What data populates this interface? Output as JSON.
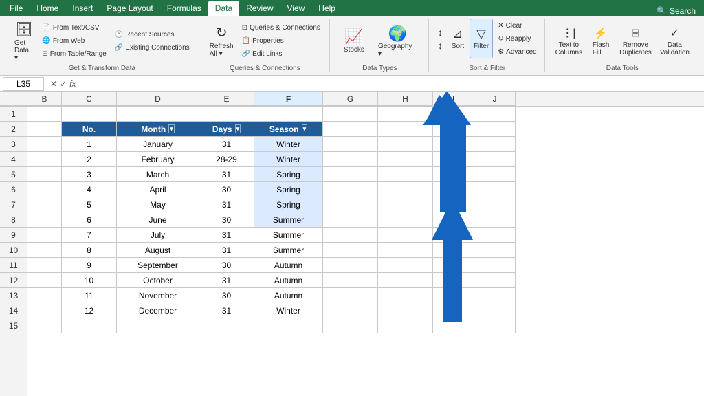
{
  "ribbon": {
    "tabs": [
      "File",
      "Home",
      "Insert",
      "Page Layout",
      "Formulas",
      "Data",
      "Review",
      "View",
      "Help"
    ],
    "active_tab": "Data",
    "groups": {
      "get_transform": {
        "label": "Get & Transform Data",
        "buttons": [
          {
            "id": "get-data",
            "label": "Get\nData",
            "icon": "🗄"
          },
          {
            "id": "from-text-csv",
            "label": "From\nText/CSV",
            "icon": "📄"
          },
          {
            "id": "from-web",
            "label": "From\nWeb",
            "icon": "🌐"
          },
          {
            "id": "from-table",
            "label": "From Table/\nRange",
            "icon": "⊞"
          },
          {
            "id": "recent-sources",
            "label": "Recent\nSources",
            "icon": "🕐"
          },
          {
            "id": "existing-connections",
            "label": "Existing\nConnections",
            "icon": "🔗"
          }
        ]
      },
      "queries": {
        "label": "Queries & Connections",
        "buttons": [
          {
            "id": "refresh-all",
            "label": "Refresh\nAll",
            "icon": "↻"
          },
          {
            "id": "queries-connections",
            "label": "Queries & Connections",
            "icon": ""
          },
          {
            "id": "properties",
            "label": "Properties",
            "icon": ""
          },
          {
            "id": "edit-links",
            "label": "Edit Links",
            "icon": ""
          }
        ]
      },
      "data_types": {
        "label": "Data Types",
        "items": [
          "Stocks",
          "Geography"
        ]
      },
      "sort_filter": {
        "label": "Sort & Filter",
        "buttons": [
          "Sort A-Z",
          "Sort Z-A",
          "Sort",
          "Filter",
          "Clear",
          "Reapply",
          "Advanced"
        ]
      },
      "data_tools": {
        "label": "Data Tools",
        "buttons": [
          "Text to Columns",
          "Flash Fill",
          "Remove Duplicates",
          "Data Validation"
        ]
      }
    }
  },
  "formula_bar": {
    "name_box": "L35",
    "formula": ""
  },
  "columns": {
    "headers": [
      "",
      "B",
      "C",
      "D",
      "E",
      "F",
      "G",
      "H",
      "I",
      "J"
    ],
    "widths": [
      40,
      50,
      80,
      120,
      80,
      100,
      80,
      80,
      60,
      60
    ]
  },
  "rows": {
    "count": 15,
    "headers": [
      "1",
      "2",
      "3",
      "4",
      "5",
      "6",
      "7",
      "8",
      "9",
      "10",
      "11",
      "12",
      "13",
      "14",
      "15"
    ]
  },
  "table": {
    "headers": [
      "No.",
      "Month",
      "Days",
      "Season"
    ],
    "data": [
      [
        1,
        "January",
        "31",
        "Winter"
      ],
      [
        2,
        "February",
        "28-29",
        "Winter"
      ],
      [
        3,
        "March",
        "31",
        "Spring"
      ],
      [
        4,
        "April",
        "30",
        "Spring"
      ],
      [
        5,
        "May",
        "31",
        "Spring"
      ],
      [
        6,
        "June",
        "30",
        "Summer"
      ],
      [
        7,
        "July",
        "31",
        "Summer"
      ],
      [
        8,
        "August",
        "31",
        "Summer"
      ],
      [
        9,
        "September",
        "30",
        "Autumn"
      ],
      [
        10,
        "October",
        "31",
        "Autumn"
      ],
      [
        11,
        "November",
        "30",
        "Autumn"
      ],
      [
        12,
        "December",
        "31",
        "Winter"
      ]
    ]
  },
  "arrow": {
    "color": "#1565C0"
  }
}
